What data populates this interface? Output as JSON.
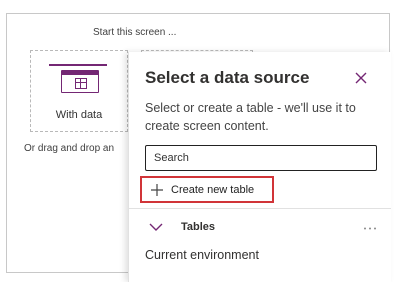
{
  "canvas": {
    "start_heading": "Start this screen ...",
    "with_data_label": "With data",
    "drag_drop_text": "Or drag and drop an"
  },
  "panel": {
    "title": "Select a data source",
    "description": "Select or create a table - we'll use it to create screen content.",
    "search_placeholder": "Search",
    "create_button_label": "Create new table",
    "section_label": "Tables",
    "environment_label": "Current environment"
  },
  "icons": {
    "close": "close-icon",
    "plus": "plus-icon",
    "chevron": "chevron-down-icon",
    "more": "more-icon",
    "table": "table-icon"
  },
  "colors": {
    "accent": "#742774",
    "highlight": "#d13438"
  }
}
